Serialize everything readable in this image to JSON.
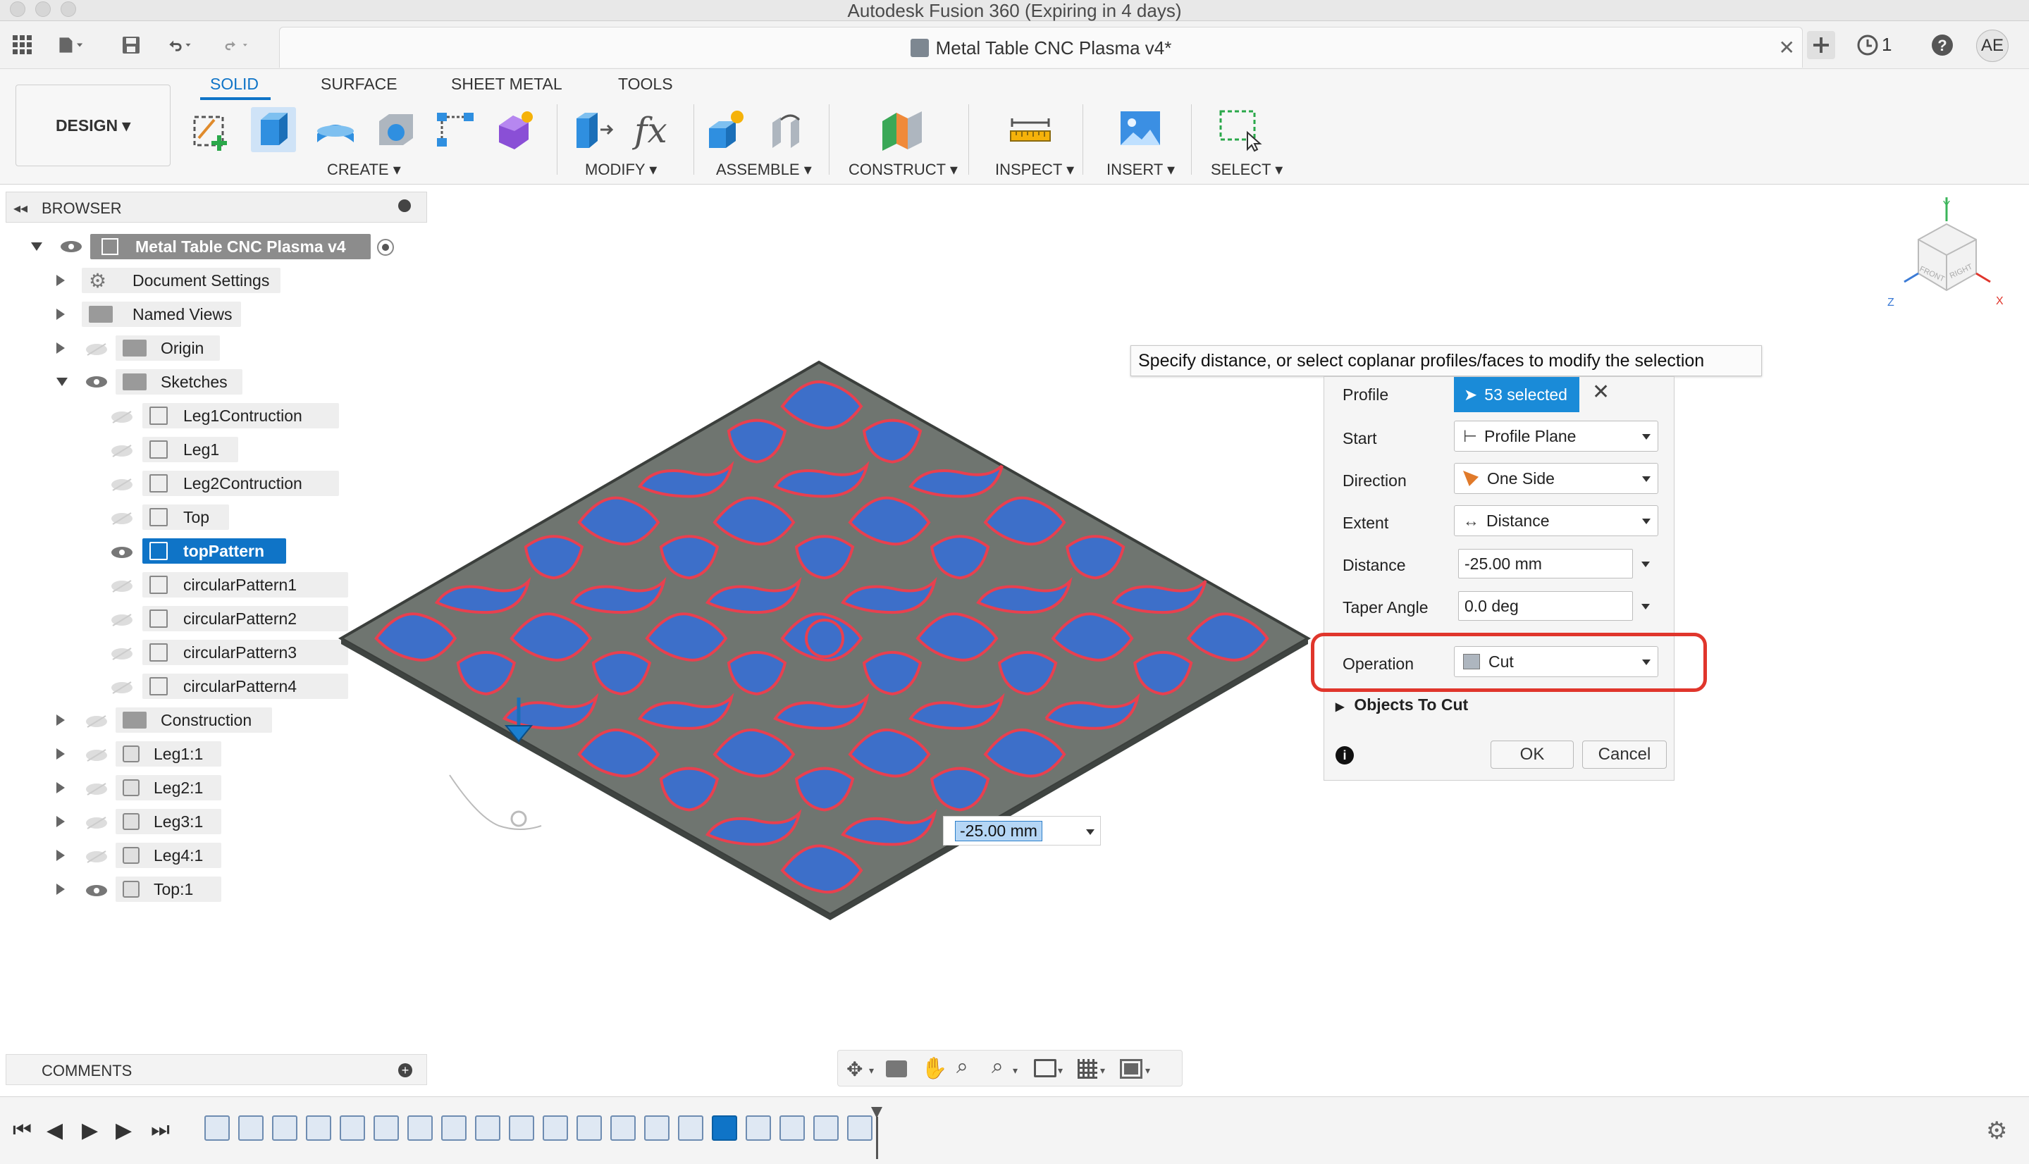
{
  "window": {
    "title": "Autodesk Fusion 360 (Expiring in 4 days)"
  },
  "quickbar": {
    "doc_tab_title": "Metal Table CNC Plasma v4*",
    "notification_count": "1",
    "user_initials": "AE"
  },
  "ribbon": {
    "workspace": "DESIGN",
    "tabs": [
      "SOLID",
      "SURFACE",
      "SHEET METAL",
      "TOOLS"
    ],
    "groups": {
      "create": "CREATE",
      "modify": "MODIFY",
      "assemble": "ASSEMBLE",
      "construct": "CONSTRUCT",
      "inspect": "INSPECT",
      "insert": "INSERT",
      "select": "SELECT"
    }
  },
  "browser": {
    "title": "BROWSER",
    "root": "Metal Table CNC Plasma v4",
    "items": {
      "document_settings": "Document Settings",
      "named_views": "Named Views",
      "origin": "Origin",
      "sketches": "Sketches",
      "construction": "Construction"
    },
    "sketches": [
      "Leg1Contruction",
      "Leg1",
      "Leg2Contruction",
      "Top",
      "topPattern",
      "circularPattern1",
      "circularPattern2",
      "circularPattern3",
      "circularPattern4"
    ],
    "bodies": [
      "Leg1:1",
      "Leg2:1",
      "Leg3:1",
      "Leg4:1",
      "Top:1"
    ]
  },
  "comments": {
    "title": "COMMENTS"
  },
  "tooltip": {
    "text": "Specify distance, or select coplanar profiles/faces to modify the selection"
  },
  "extrude": {
    "profile_label": "Profile",
    "profile_value": "53 selected",
    "start_label": "Start",
    "start_value": "Profile Plane",
    "direction_label": "Direction",
    "direction_value": "One Side",
    "extent_label": "Extent",
    "extent_value": "Distance",
    "distance_label": "Distance",
    "distance_value": "-25.00 mm",
    "taper_label": "Taper Angle",
    "taper_value": "0.0 deg",
    "operation_label": "Operation",
    "operation_value": "Cut",
    "objects_to_cut": "Objects To Cut",
    "ok": "OK",
    "cancel": "Cancel"
  },
  "manipulator": {
    "distance": "-25.00 mm"
  },
  "viewcube": {
    "y": "Y",
    "x": "X",
    "z": "Z",
    "front": "FRONT",
    "right": "RIGHT"
  },
  "colors": {
    "accent": "#0f74c7",
    "profile_fill": "#3d6fc9",
    "plate": "#6f7570",
    "cut_edge": "#e8404f",
    "highlight": "#e0362c"
  }
}
